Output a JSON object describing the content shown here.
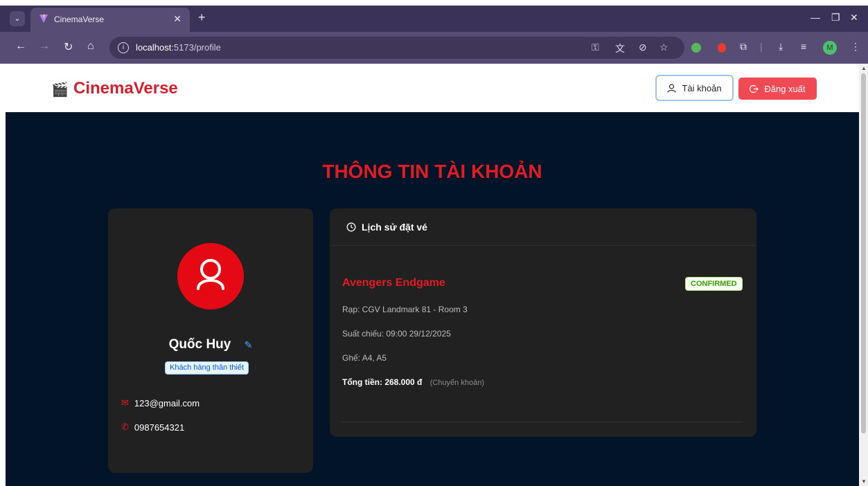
{
  "browser": {
    "tab_title": "CinemaVerse",
    "url_host": "localhost",
    "url_path": ":5173/profile"
  },
  "header": {
    "logo_icon": "🎬",
    "logo_text": "CinemaVerse",
    "account_label": "Tài khoản",
    "logout_label": "Đăng xuất"
  },
  "page": {
    "title": "THÔNG TIN TÀI KHOẢN"
  },
  "profile": {
    "name": "Quốc Huy",
    "badge": "Khách hàng thân thiết",
    "email": "123@gmail.com",
    "phone": "0987654321"
  },
  "history": {
    "title": "Lịch sử đặt vé",
    "booking": {
      "movie": "Avengers Endgame",
      "status": "CONFIRMED",
      "theater": "Rạp: CGV Landmark 81 - Room 3",
      "showtime": "Suất chiếu: 09:00 29/12/2025",
      "seats": "Ghế: A4, A5",
      "total": "Tổng tiền: 268.000 đ",
      "payment_method": "(Chuyển khoản)"
    }
  },
  "colors": {
    "brand_red": "#e31b23",
    "page_bg": "#021428",
    "card_bg": "#212121",
    "confirmed_green": "#389e0d"
  }
}
